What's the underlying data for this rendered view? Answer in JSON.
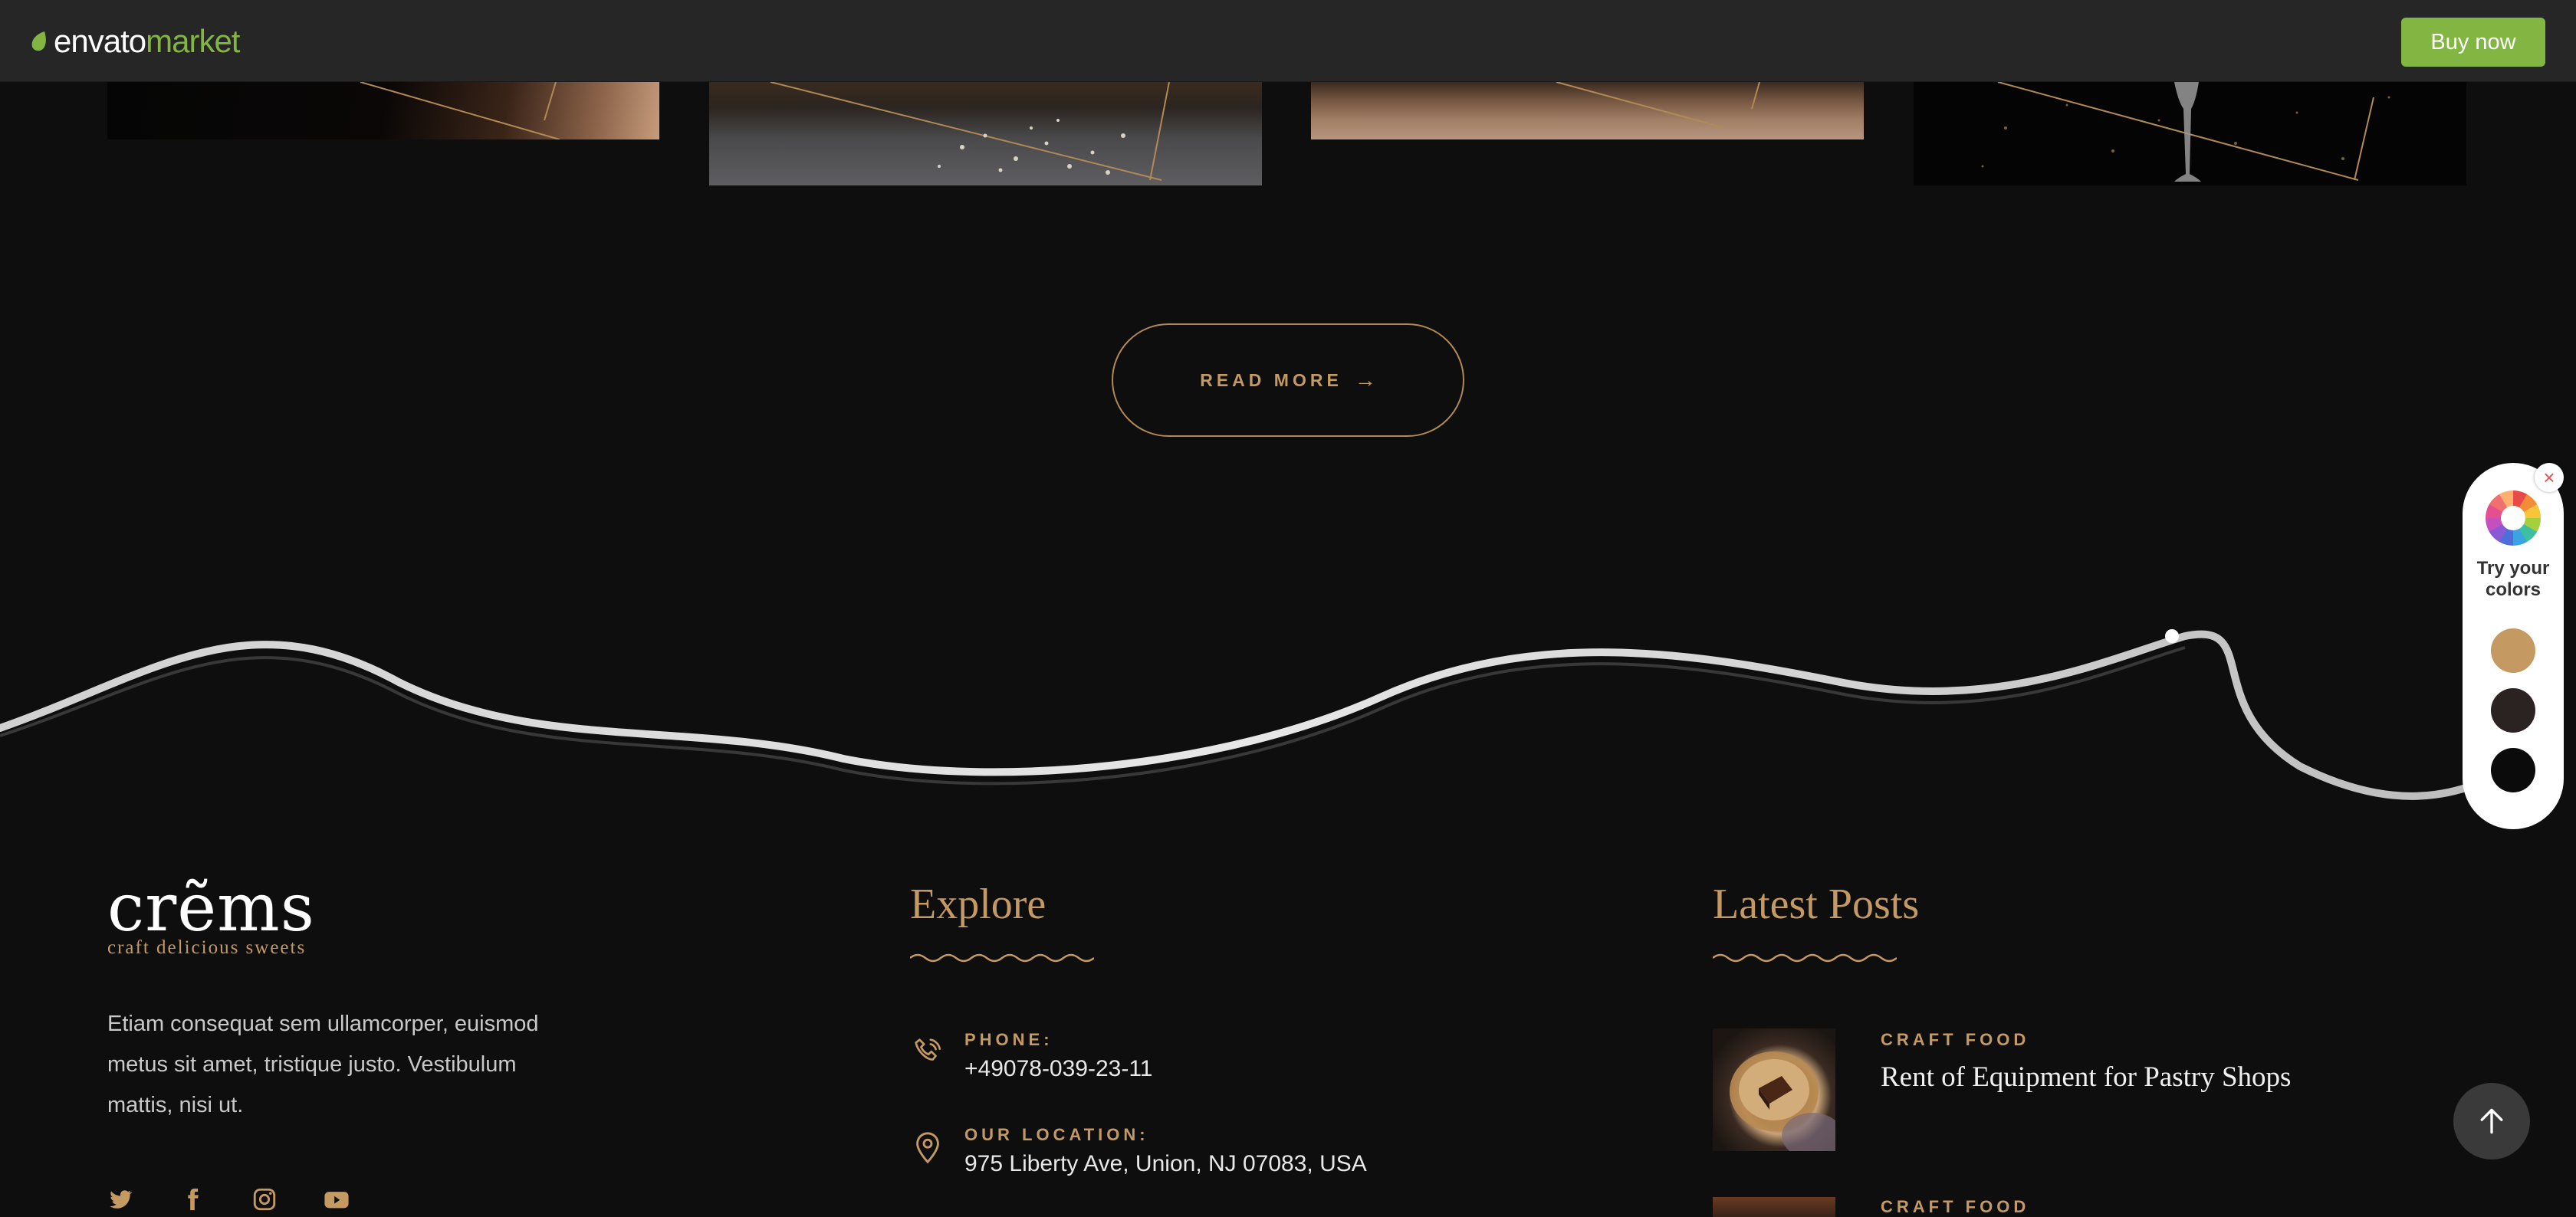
{
  "topbar": {
    "logo_word1": "envato",
    "logo_word2": "market",
    "buy_label": "Buy now",
    "accent": "#82b541"
  },
  "read_more": {
    "label": "READ MORE",
    "arrow": "→"
  },
  "color_picker": {
    "close_glyph": "×",
    "title": "Try your colors",
    "swatches": [
      "#c49a62",
      "#2b2322",
      "#0b0b0b"
    ]
  },
  "footer": {
    "logo": "crẽms",
    "tagline": "craft delicious sweets",
    "about": "Etiam consequat sem ullamcorper, euismod metus sit amet, tristique justo. Vestibulum mattis, nisi ut.",
    "socials": [
      "twitter-icon",
      "facebook-icon",
      "instagram-icon",
      "youtube-icon"
    ],
    "explore": {
      "title": "Explore",
      "phone_label": "PHONE:",
      "phone_value": "+49078-039-23-11",
      "location_label": "OUR LOCATION:",
      "location_value": "975 Liberty Ave, Union, NJ 07083, USA"
    },
    "latest_posts": {
      "title": "Latest Posts",
      "posts": [
        {
          "category": "CRAFT FOOD",
          "title": "Rent of Equipment for Pastry Shops"
        },
        {
          "category": "CRAFT FOOD",
          "title": ""
        }
      ]
    }
  },
  "accent_gold": "#c49a62"
}
